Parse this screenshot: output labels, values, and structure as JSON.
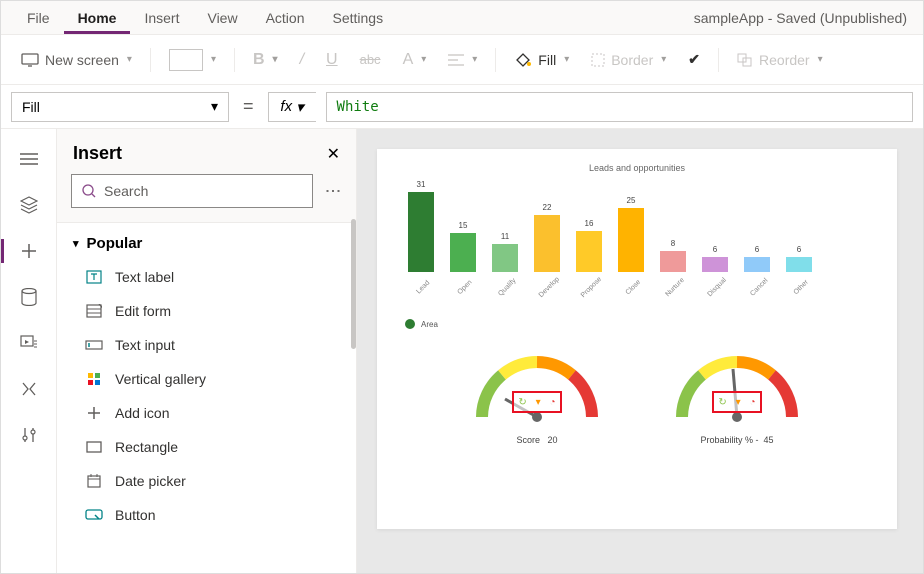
{
  "app": {
    "title": "sampleApp - Saved (Unpublished)"
  },
  "menubar": {
    "file": "File",
    "home": "Home",
    "insert": "Insert",
    "view": "View",
    "action": "Action",
    "settings": "Settings"
  },
  "toolbar": {
    "new_screen": "New screen",
    "fill": "Fill",
    "border": "Border",
    "reorder": "Reorder"
  },
  "formula": {
    "prop": "Fill",
    "fx": "fx",
    "value": "White"
  },
  "insertPane": {
    "title": "Insert",
    "search_placeholder": "Search",
    "category": "Popular",
    "items": [
      {
        "label": "Text label"
      },
      {
        "label": "Edit form"
      },
      {
        "label": "Text input"
      },
      {
        "label": "Vertical gallery"
      },
      {
        "label": "Add icon"
      },
      {
        "label": "Rectangle"
      },
      {
        "label": "Date picker"
      },
      {
        "label": "Button"
      }
    ]
  },
  "chart_data": {
    "type": "bar",
    "title": "Leads and opportunities",
    "categories": [
      "Lead",
      "Open",
      "Qualify",
      "Develop",
      "Propose",
      "Close",
      "Nurture",
      "Disqual",
      "Cancel",
      "Other"
    ],
    "values": [
      31,
      15,
      11,
      22,
      16,
      25,
      8,
      6,
      6,
      6
    ],
    "colors": [
      "#2e7d32",
      "#4caf50",
      "#81c784",
      "#fbc02d",
      "#ffca28",
      "#ffb300",
      "#ef9a9a",
      "#ce93d8",
      "#90caf9",
      "#80deea"
    ],
    "legend": "Area",
    "ylim": [
      0,
      35
    ]
  },
  "gauges": {
    "left": {
      "label": "Score",
      "value": "20"
    },
    "right": {
      "label": "Probability % -",
      "value": "45"
    }
  }
}
